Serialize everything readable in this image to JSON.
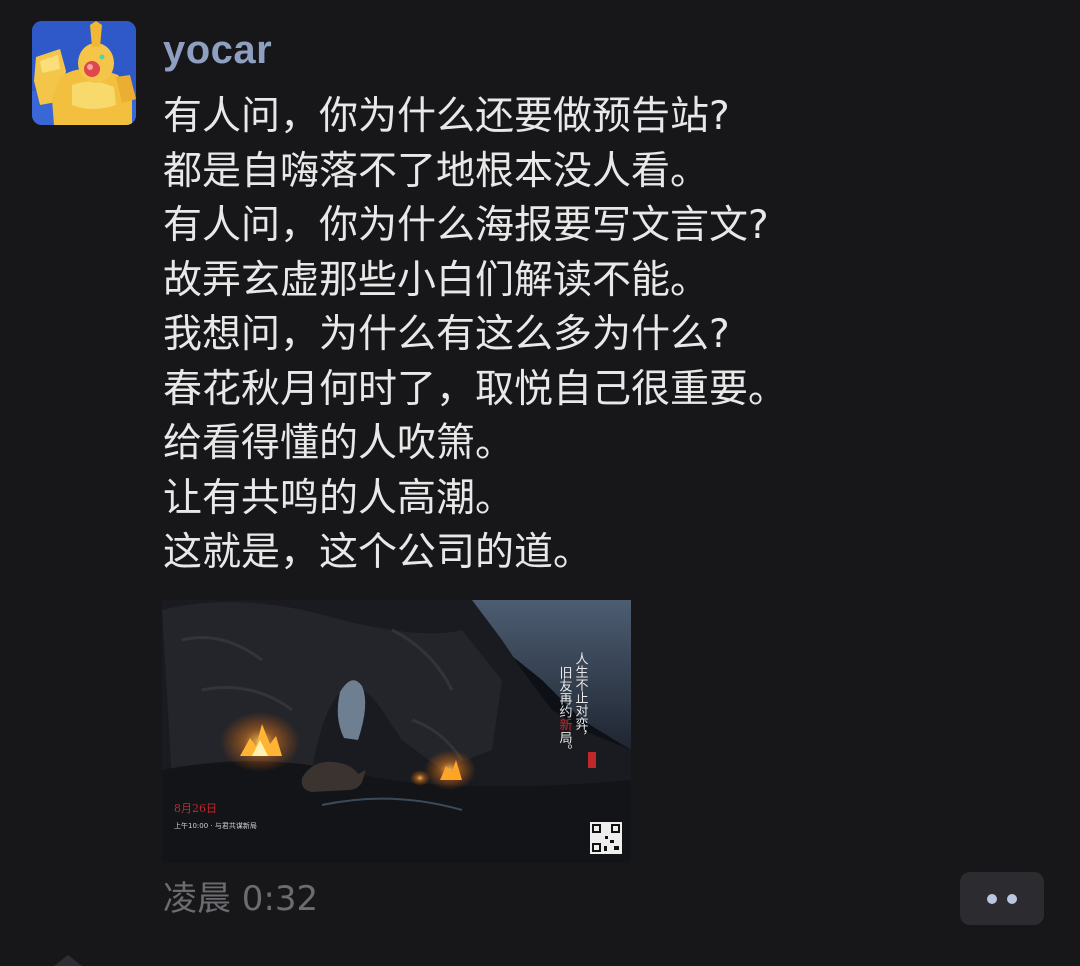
{
  "post": {
    "author": "yocar",
    "avatar_icon": "yellow-figure-avatar-icon",
    "lines": [
      "有人问，你为什么还要做预告站?",
      "都是自嗨落不了地根本没人看。",
      "有人问，你为什么海报要写文言文?",
      "故弄玄虚那些小白们解读不能。",
      "我想问，为什么有这么多为什么?",
      "春花秋月何时了，取悦自己很重要。",
      "给看得懂的人吹箫。",
      "让有共鸣的人高潮。",
      "这就是，这个公司的道。"
    ],
    "timestamp": "凌晨 0:32",
    "more_icon": "more-dots-icon"
  },
  "poster": {
    "vertical_text_col1": "人生不止对弈，",
    "vertical_text_col2_pre": "旧友再约",
    "vertical_text_col2_red": "新",
    "vertical_text_col2_post": "局。",
    "date_text": "8月26日",
    "small_text": "上午10:00 · 与君共谋新局",
    "colors": {
      "sky": "#3b4a5c",
      "fire": "#ffb033",
      "seal_red": "#c0282a"
    }
  },
  "theme": {
    "background": "#17171a",
    "username_color": "#8e9fc2",
    "text_color": "#e8e8e8",
    "timestamp_color": "#6c6c70",
    "button_bg": "#2c2c30"
  }
}
